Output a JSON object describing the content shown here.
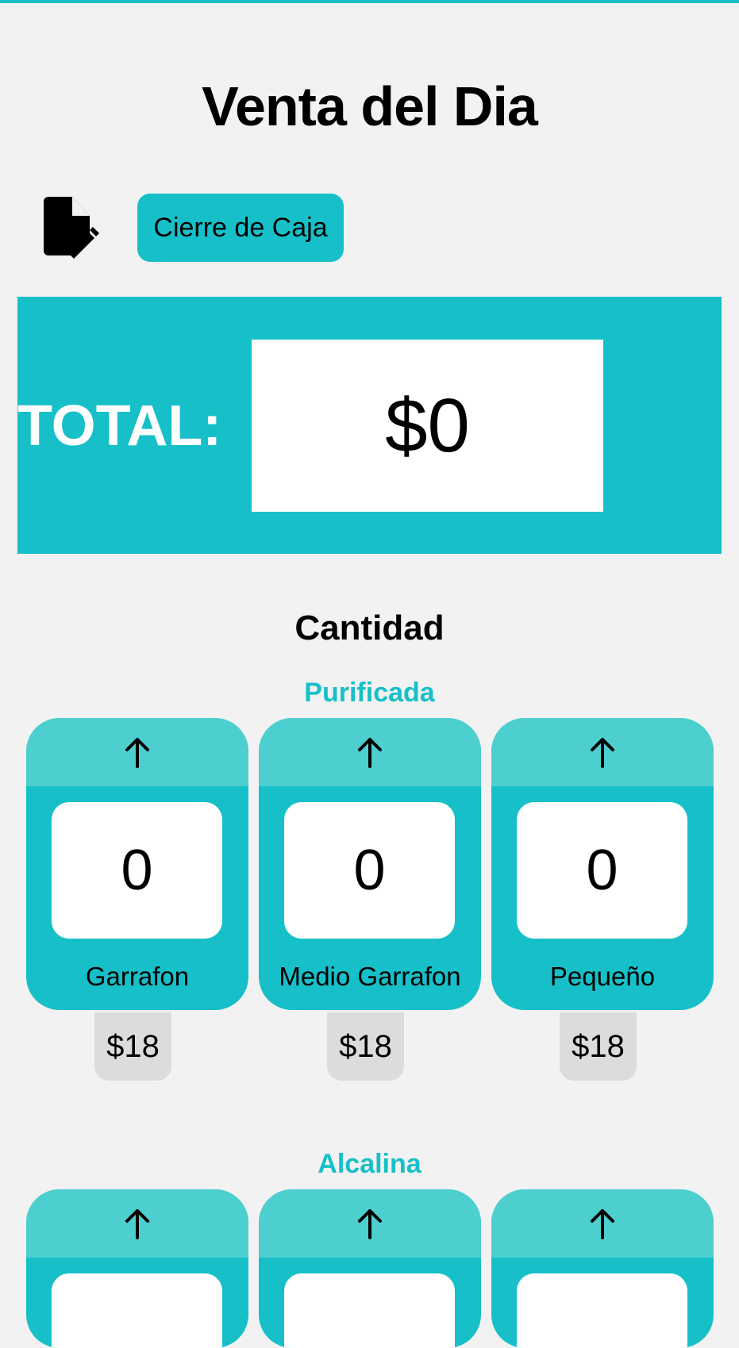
{
  "header": {
    "title": "Venta del Dia"
  },
  "toolbar": {
    "edit_icon": "edit-document-icon",
    "close_label": "Cierre de Caja"
  },
  "total": {
    "label": "TOTAL:",
    "value": "$0"
  },
  "quantity_section": {
    "heading": "Cantidad"
  },
  "groups": [
    {
      "title": "Purificada",
      "products": [
        {
          "name": "Garrafon",
          "quantity": "0",
          "price": "$18"
        },
        {
          "name": "Medio Garrafon",
          "quantity": "0",
          "price": "$18"
        },
        {
          "name": "Pequeño",
          "quantity": "0",
          "price": "$18"
        }
      ]
    },
    {
      "title": "Alcalina",
      "products": []
    }
  ],
  "colors": {
    "accent": "#17c0c8",
    "card_top": "#4ecfcf",
    "background": "#f2f2f2",
    "price_badge": "#dcdcdc"
  },
  "icons": {
    "increment": "arrow-up-icon"
  }
}
